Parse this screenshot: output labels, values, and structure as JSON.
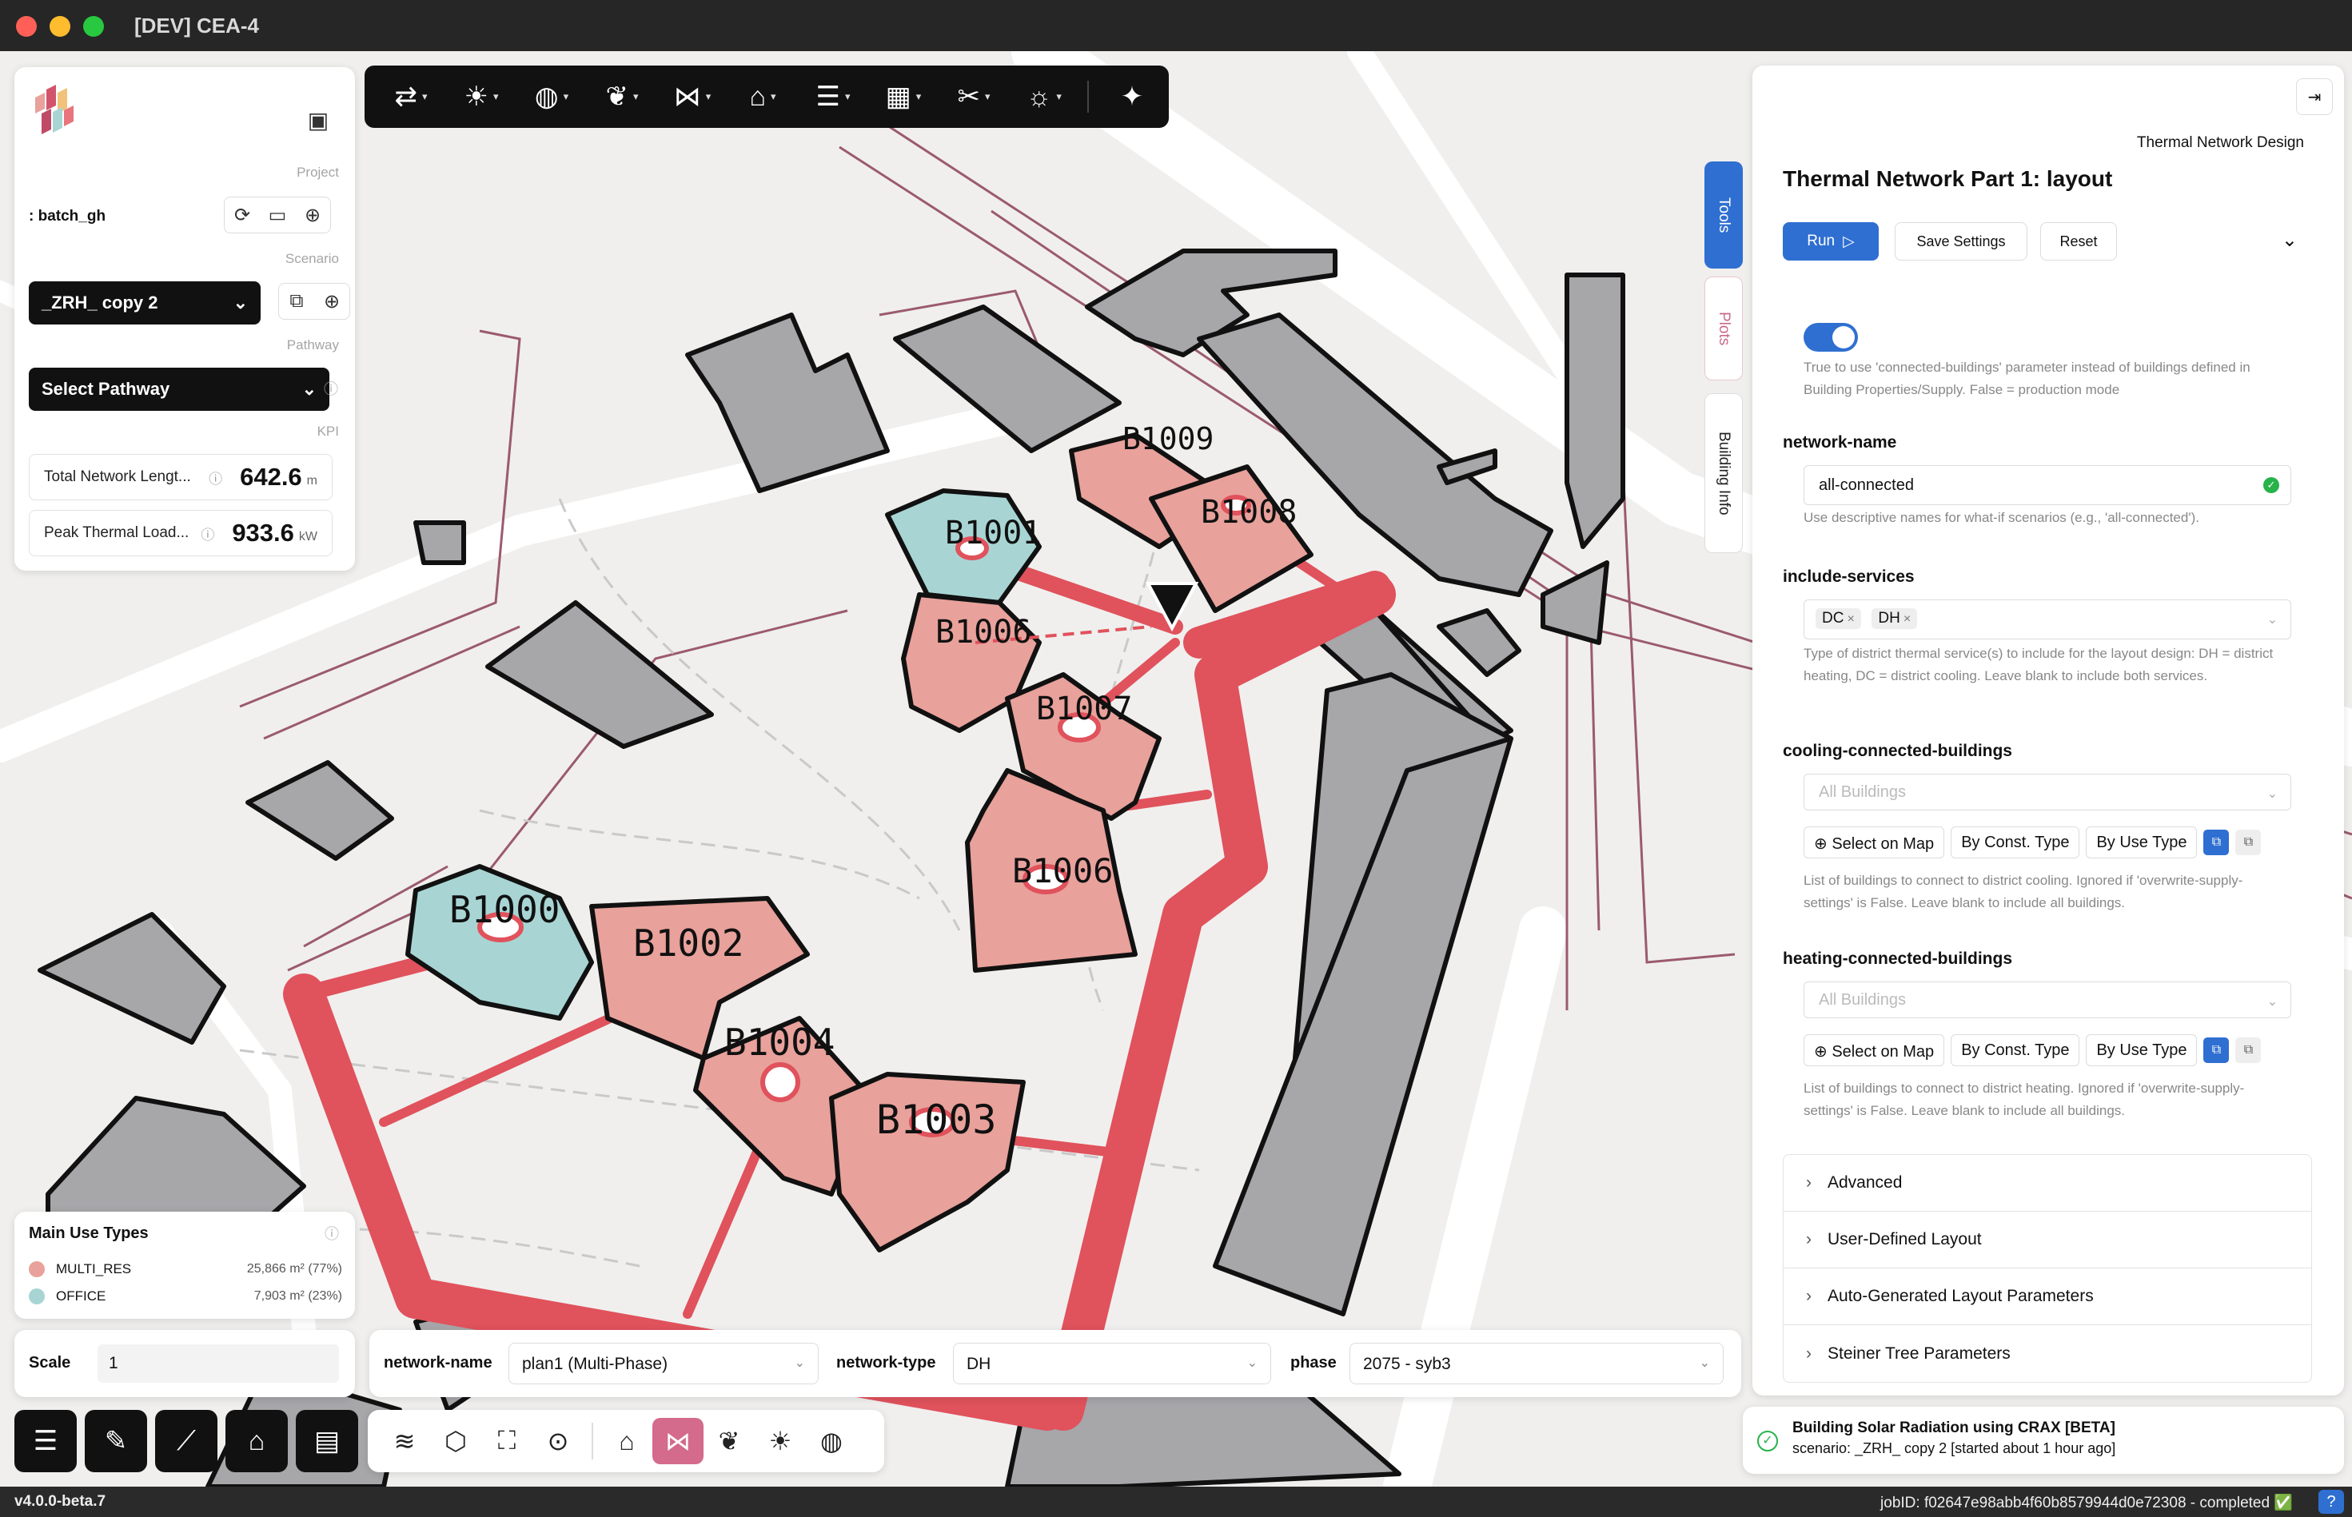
{
  "window": {
    "title": "[DEV] CEA-4"
  },
  "project": {
    "section_label": "Project",
    "name": ": batch_gh",
    "scenario_label": "Scenario",
    "scenario_value": "_ZRH_ copy 2",
    "pathway_label": "Pathway",
    "pathway_value": "Select Pathway",
    "kpi_label": "KPI",
    "kpis": [
      {
        "label": "Total Network Lengt...",
        "value": "642.6",
        "unit": "m"
      },
      {
        "label": "Peak Thermal Load...",
        "value": "933.6",
        "unit": "kW"
      }
    ]
  },
  "toolbar": {
    "tools": [
      {
        "icon": "arrows-swap-icon"
      },
      {
        "icon": "sun-icon"
      },
      {
        "icon": "globe-icon"
      },
      {
        "icon": "leaf-icon"
      },
      {
        "icon": "network-icon"
      },
      {
        "icon": "tag-icon"
      },
      {
        "icon": "sliders-icon"
      },
      {
        "icon": "calculator-icon"
      },
      {
        "icon": "tools-icon"
      },
      {
        "icon": "lightbulb-icon"
      }
    ],
    "extra_icon": "sparkle-icon"
  },
  "map": {
    "buildings": [
      {
        "id": "B1000",
        "use": "OFFICE"
      },
      {
        "id": "B1001",
        "use": "OFFICE"
      },
      {
        "id": "B1002",
        "use": "MULTI_RES"
      },
      {
        "id": "B1003",
        "use": "MULTI_RES"
      },
      {
        "id": "B1004",
        "use": "MULTI_RES"
      },
      {
        "id": "B1006",
        "use": "MULTI_RES"
      },
      {
        "id": "B1007",
        "use": "MULTI_RES"
      },
      {
        "id": "B1008",
        "use": "MULTI_RES"
      },
      {
        "id": "B1009",
        "use": "MULTI_RES"
      }
    ],
    "colors": {
      "multi_res": "#e8a19b",
      "office": "#a8d5d4",
      "network": "#e0525c",
      "context_building": "#a7a6a9"
    }
  },
  "legend": {
    "title": "Main Use Types",
    "items": [
      {
        "label": "MULTI_RES",
        "value": "25,866 m² (77%)",
        "color": "#e8a19b"
      },
      {
        "label": "OFFICE",
        "value": "7,903 m² (23%)",
        "color": "#a8d5d4"
      }
    ]
  },
  "scale": {
    "label": "Scale",
    "value": "1"
  },
  "network_bar": {
    "network_name_label": "network-name",
    "network_name_value": "plan1 (Multi-Phase)",
    "network_type_label": "network-type",
    "network_type_value": "DH",
    "phase_label": "phase",
    "phase_value": "2075 - syb3"
  },
  "side_tabs": {
    "tools": "Tools",
    "plots": "Plots",
    "building_info": "Building Info"
  },
  "right_panel": {
    "kicker": "Thermal Network Design",
    "title": "Thermal Network Part 1: layout",
    "run_label": "Run",
    "save_label": "Save Settings",
    "reset_label": "Reset",
    "toggle_help": "True to use 'connected-buildings' parameter instead of buildings defined in Building Properties/Supply. False = production mode",
    "network_name": {
      "label": "network-name",
      "value": "all-connected",
      "help": "Use descriptive names for what-if scenarios (e.g., 'all-connected')."
    },
    "include_services": {
      "label": "include-services",
      "chips": [
        "DC",
        "DH"
      ],
      "help": "Type of district thermal service(s) to include for the layout design: DH = district heating, DC = district cooling. Leave blank to include both services."
    },
    "cooling": {
      "label": "cooling-connected-buildings",
      "placeholder": "All Buildings",
      "select_on_map": "Select on Map",
      "by_const": "By Const. Type",
      "by_use": "By Use Type",
      "help": "List of buildings to connect to district cooling. Ignored if 'overwrite-supply-settings' is False. Leave blank to include all buildings."
    },
    "heating": {
      "label": "heating-connected-buildings",
      "placeholder": "All Buildings",
      "select_on_map": "Select on Map",
      "by_const": "By Const. Type",
      "by_use": "By Use Type",
      "help": "List of buildings to connect to district heating. Ignored if 'overwrite-supply-settings' is False. Leave blank to include all buildings."
    },
    "sections": [
      "Advanced",
      "User-Defined Layout",
      "Auto-Generated Layout Parameters",
      "Steiner Tree Parameters"
    ]
  },
  "job": {
    "title": "Building Solar Radiation using CRAX [BETA]",
    "subtitle": "scenario: _ZRH_ copy 2 [started about 1 hour ago]"
  },
  "status_bar": {
    "version": "v4.0.0-beta.7",
    "job_info": "jobID: f02647e98abb4f60b8579944d0e72308 - completed ✅",
    "help": "?"
  }
}
